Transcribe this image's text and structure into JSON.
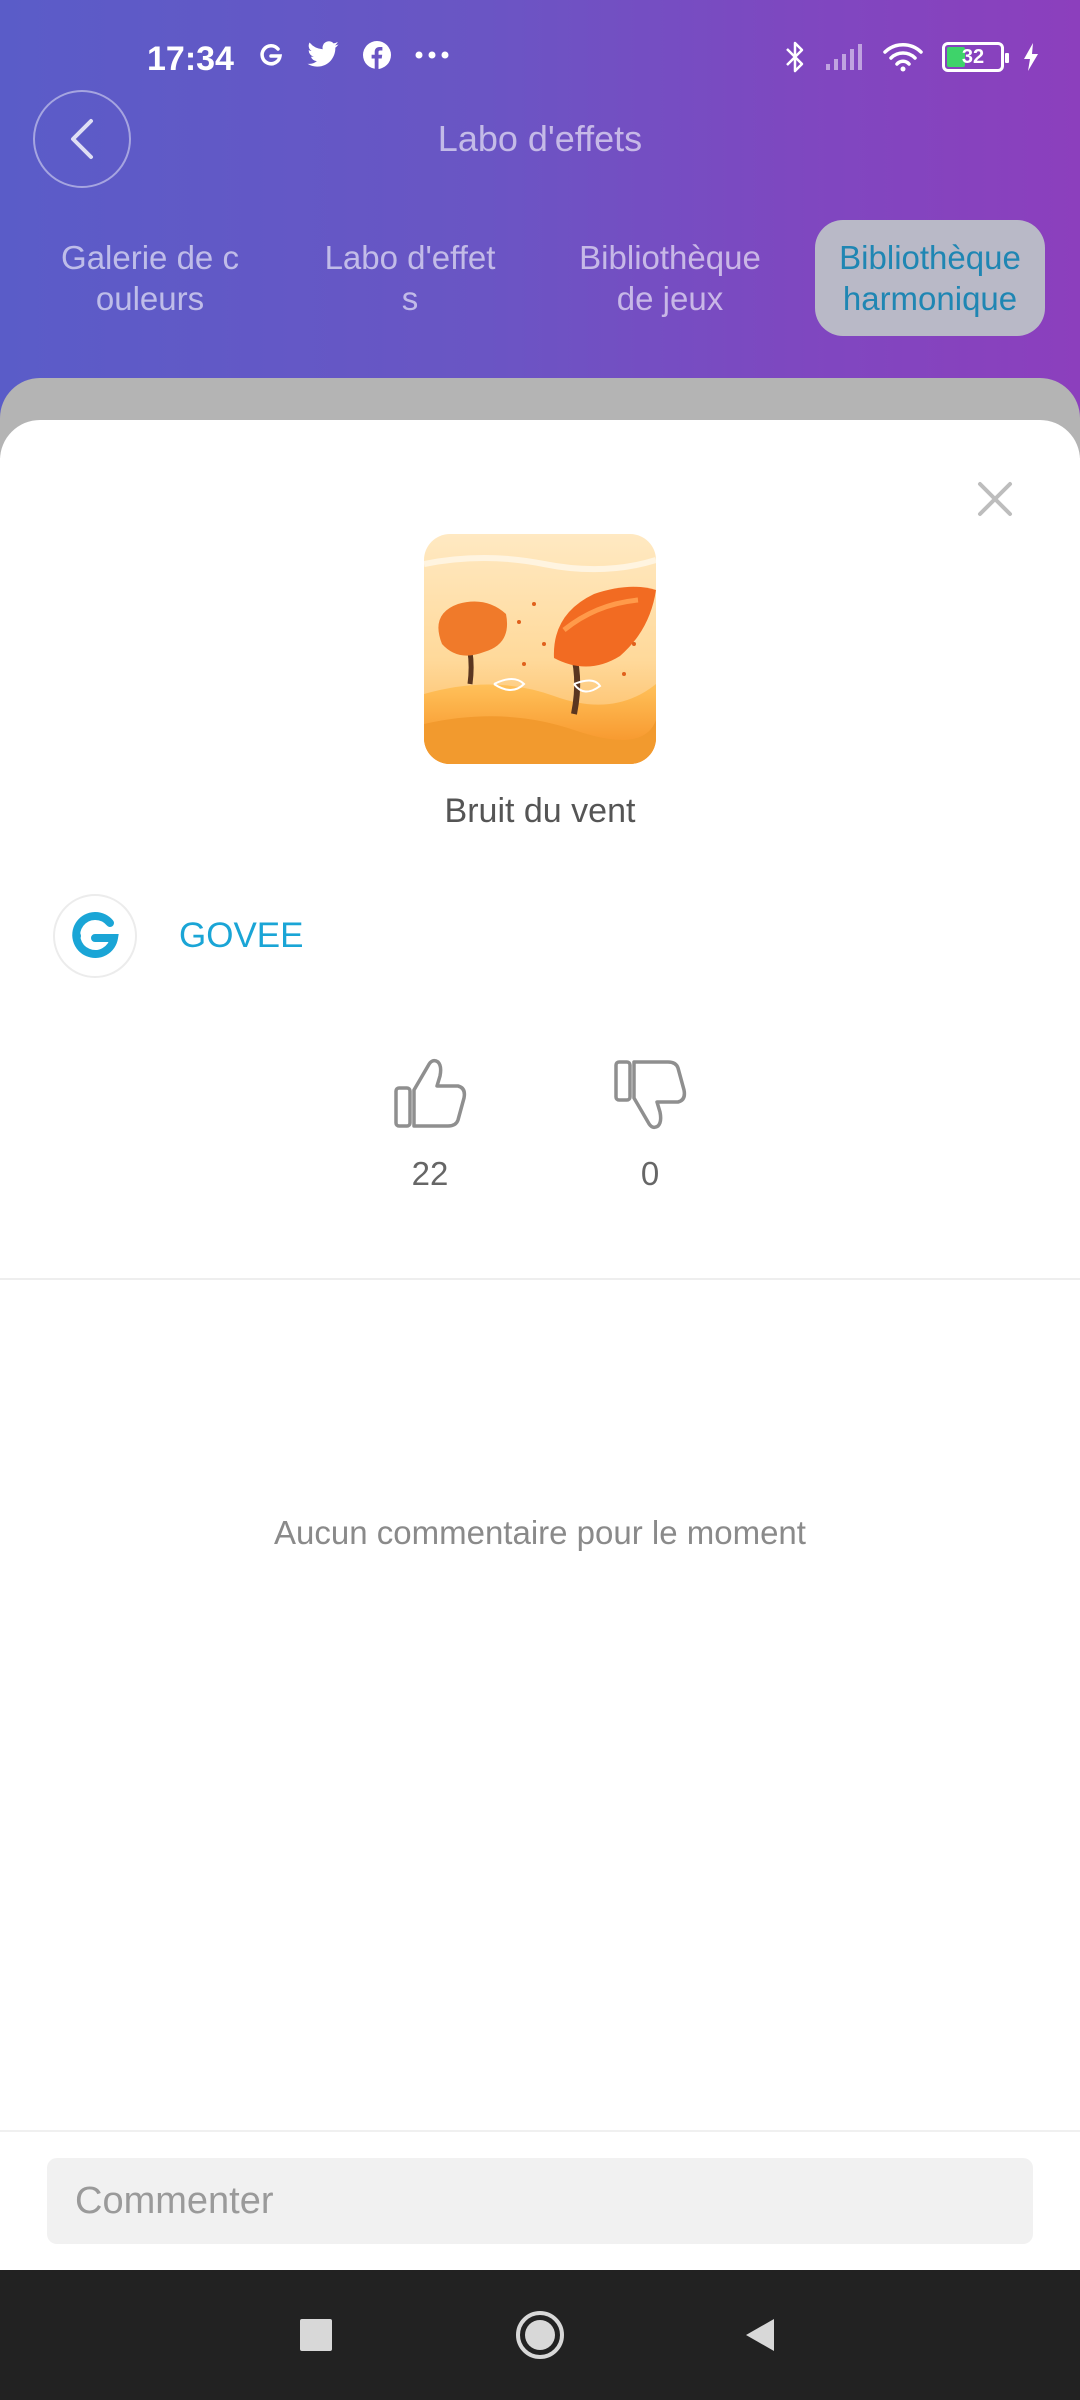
{
  "status_bar": {
    "time": "17:34",
    "battery": "32",
    "left_icons": [
      "govee-icon",
      "twitter-icon",
      "facebook-icon",
      "more-dots-icon"
    ],
    "right_icons": [
      "bluetooth-icon",
      "signal-icon",
      "wifi-icon",
      "battery-icon",
      "charging-icon"
    ]
  },
  "header": {
    "title": "Labo d'effets",
    "tabs": [
      {
        "label": "Galerie de c\nouleurs",
        "active": false
      },
      {
        "label": "Labo d'effet\ns",
        "active": false
      },
      {
        "label": "Bibliothèque\nde jeux",
        "active": false
      },
      {
        "label": "Bibliothèque\nharmonique",
        "active": true
      }
    ]
  },
  "effect": {
    "name": "Bruit du vent",
    "author": "GOVEE",
    "likes": "22",
    "dislikes": "0"
  },
  "comments": {
    "empty_text": "Aucun commentaire pour le moment",
    "input_placeholder": "Commenter"
  },
  "colors": {
    "header_gradient_start": "#5a5cc8",
    "header_gradient_end": "#8c3fbd",
    "accent_blue": "#1aa5d6",
    "active_tab_bg": "#b9b9c7"
  }
}
